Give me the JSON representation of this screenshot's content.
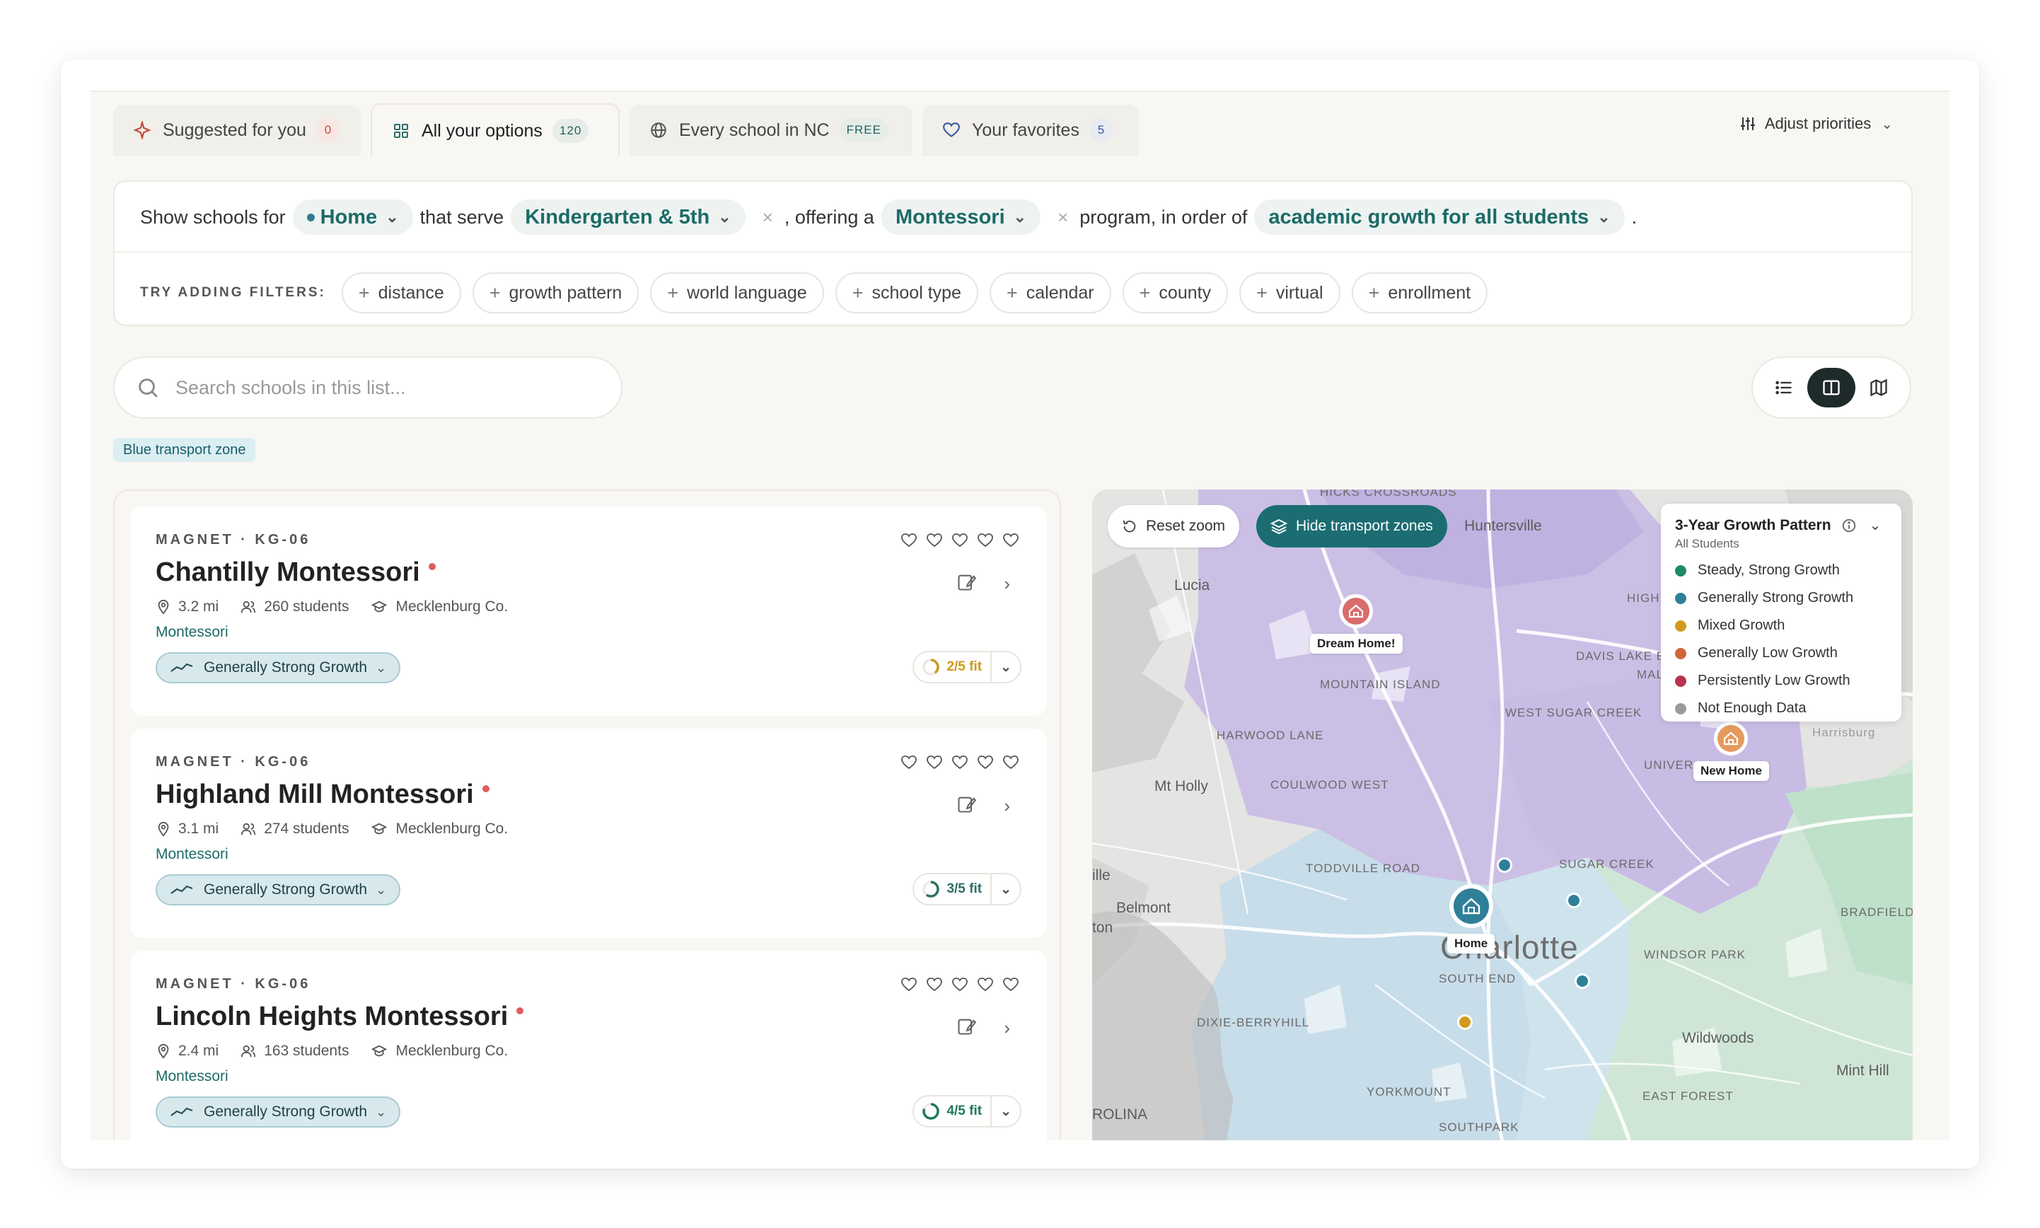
{
  "tabs": [
    {
      "label": "Suggested for you",
      "count": "0",
      "icon": "sparkle-icon"
    },
    {
      "label": "All your options",
      "count": "120",
      "icon": "grid-icon"
    },
    {
      "label": "Every school in NC",
      "count": "FREE",
      "icon": "globe-icon"
    },
    {
      "label": "Your favorites",
      "count": "5",
      "icon": "heart-icon"
    }
  ],
  "adjust_label": "Adjust priorities",
  "query": {
    "prefix": "Show schools for",
    "location": "Home",
    "serve": "that serve",
    "grades": "Kindergarten & 5th",
    "offering": ", offering a",
    "program": "Montessori",
    "program_suffix": "program, in order of",
    "order": "academic growth for all students",
    "period": "."
  },
  "filters": {
    "label": "TRY ADDING FILTERS:",
    "chips": [
      "distance",
      "growth pattern",
      "world language",
      "school type",
      "calendar",
      "county",
      "virtual",
      "enrollment"
    ]
  },
  "search": {
    "placeholder": "Search schools in this list..."
  },
  "zone_tag": "Blue transport zone",
  "schools": [
    {
      "meta": "MAGNET · KG-06",
      "name": "Chantilly Montessori",
      "distance": "3.2 mi",
      "students": "260 students",
      "county": "Mecklenburg Co.",
      "program": "Montessori",
      "growth": "Generally Strong Growth",
      "fit": "2/5 fit",
      "fit_score": 0.4,
      "fit_color": "#c99a1a"
    },
    {
      "meta": "MAGNET · KG-06",
      "name": "Highland Mill Montessori",
      "distance": "3.1 mi",
      "students": "274 students",
      "county": "Mecklenburg Co.",
      "program": "Montessori",
      "growth": "Generally Strong Growth",
      "fit": "3/5 fit",
      "fit_score": 0.6,
      "fit_color": "#2e6f66"
    },
    {
      "meta": "MAGNET · KG-06",
      "name": "Lincoln Heights Montessori",
      "distance": "2.4 mi",
      "students": "163 students",
      "county": "Mecklenburg Co.",
      "program": "Montessori",
      "growth": "Generally Strong Growth",
      "fit": "4/5 fit",
      "fit_score": 0.8,
      "fit_color": "#1f7a5c"
    }
  ],
  "map": {
    "reset_label": "Reset zoom",
    "hide_label": "Hide transport zones",
    "legend": {
      "title": "3-Year Growth Pattern",
      "subtitle": "All Students",
      "items": [
        {
          "label": "Steady, Strong Growth",
          "color": "#1f8a6a"
        },
        {
          "label": "Generally Strong Growth",
          "color": "#2f7f99"
        },
        {
          "label": "Mixed Growth",
          "color": "#d19a1e"
        },
        {
          "label": "Generally Low Growth",
          "color": "#d0643a"
        },
        {
          "label": "Persistently Low Growth",
          "color": "#b8334e"
        },
        {
          "label": "Not Enough Data",
          "color": "#9a9a9a"
        }
      ]
    },
    "pins": {
      "dream": "Dream Home!",
      "home": "Home",
      "new": "New Home"
    },
    "places": {
      "huntersville": "Huntersville",
      "lucia": "Lucia",
      "hicks": "HICKS CROSSROADS",
      "mountain_island": "MOUNTAIN ISLAND",
      "harwood": "HARWOOD LANE",
      "mt_holly": "Mt Holly",
      "coulwood": "COULWOOD WEST",
      "west_sugar": "WEST SUGAR CREEK",
      "davis_lake": "DAVIS LAKE EASTFIELD",
      "mallard": "MALLA",
      "high": "HIGH CRE",
      "univer": "UNIVER",
      "toddville": "TODDVILLE ROAD",
      "sugar_creek": "SUGAR CREEK",
      "belmont": "Belmont",
      "ille": "ille",
      "ton": "ton",
      "charlotte": "Charlotte",
      "south_end": "SOUTH END",
      "windsor": "WINDSOR PARK",
      "bradfield": "BRADFIELD FARMS",
      "dixie": "DIXIE-BERRYHILL",
      "wildwoods": "Wildwoods",
      "mint_hill": "Mint Hill",
      "yorkmount": "YORKMOUNT",
      "east_forest": "EAST FOREST",
      "southpark": "SOUTHPARK",
      "rolina": "ROLINA",
      "harrisburg": "Harrisburg"
    }
  }
}
